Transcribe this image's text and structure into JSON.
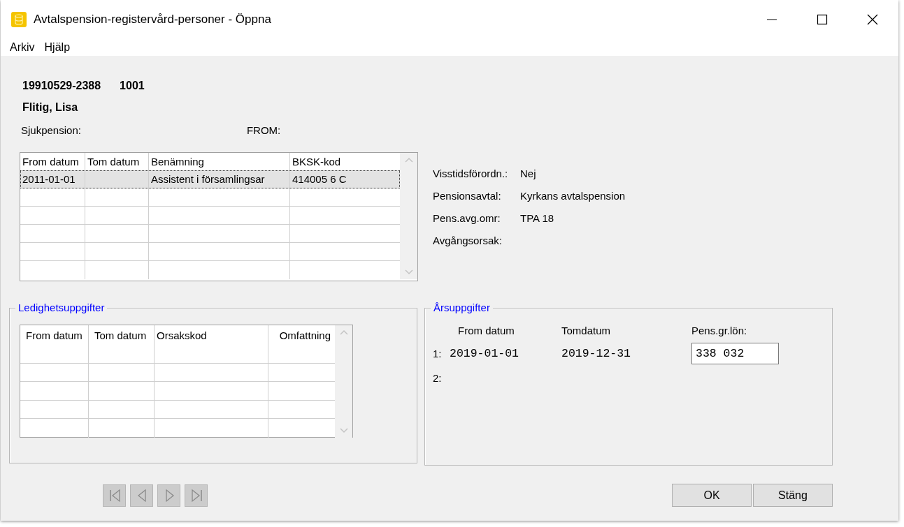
{
  "window": {
    "title": "Avtalspension-registervård-personer - Öppna"
  },
  "menu": [
    "Arkiv",
    "Hjälp"
  ],
  "person": {
    "personnummer": "19910529-2388",
    "number": "1001",
    "name": "Flitig, Lisa"
  },
  "fields": [
    {
      "label": "Sjukpension:"
    },
    {
      "label": "FROM:"
    }
  ],
  "employment_table": {
    "columns": [
      "From datum",
      "Tom datum",
      "Benämning",
      "BKSK-kod"
    ],
    "rows": [
      {
        "from_datum": "2011-01-01",
        "benamning": "Assistent i församlingsar",
        "bksk_kod": "414005 6 C",
        "selected": true
      }
    ]
  },
  "details": [
    {
      "label": "Visstidsförordn.:",
      "value": "Nej"
    },
    {
      "label": "Pensionsavtal:",
      "value": "Kyrkans avtalspension"
    },
    {
      "label": "Pens.avg.omr:",
      "value": "TPA 18"
    },
    {
      "label": "Avgångsorsak:"
    }
  ],
  "leave": {
    "title": "Ledighetsuppgifter",
    "columns": [
      "From datum",
      "Tom datum",
      "Orsakskod",
      "Omfattning"
    ]
  },
  "yearly": {
    "title": "Årsuppgifter",
    "columns": [
      "From datum",
      "Tomdatum",
      "Pens.gr.lön:"
    ],
    "rows": [
      {
        "index": "1:",
        "from_datum": "2019-01-01",
        "tom_datum": "2019-12-31",
        "pens_gr_lon": "338 032"
      },
      {
        "index": "2:"
      }
    ]
  },
  "nav_buttons": [
    {
      "kind": "first",
      "disabled": true
    },
    {
      "kind": "previous",
      "disabled": true
    },
    {
      "kind": "next",
      "disabled": true
    },
    {
      "kind": "last",
      "disabled": true
    }
  ],
  "buttons": [
    "OK",
    "Stäng"
  ]
}
